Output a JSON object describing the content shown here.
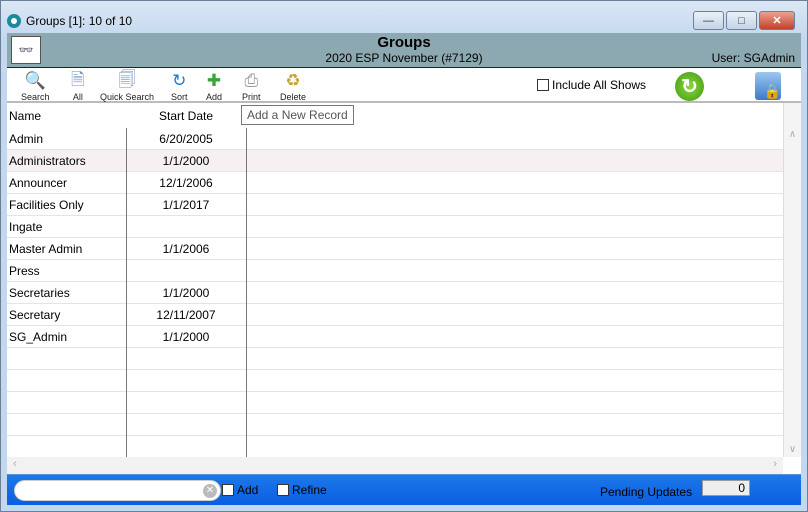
{
  "window": {
    "title": "Groups [1]: 10 of 10"
  },
  "header": {
    "title": "Groups",
    "subtitle": "2020 ESP November (#7129)",
    "user": "User: SGAdmin"
  },
  "toolbar": {
    "search": "Search",
    "all": "All",
    "quick_search": "Quick Search",
    "sort": "Sort",
    "add": "Add",
    "print": "Print",
    "delete": "Delete",
    "include_all_shows": "Include All Shows"
  },
  "tooltip": "Add a New Record",
  "grid": {
    "columns": [
      "Name",
      "Start Date"
    ],
    "rows": [
      [
        "Admin",
        "6/20/2005"
      ],
      [
        "Administrators",
        "1/1/2000"
      ],
      [
        "Announcer",
        "12/1/2006"
      ],
      [
        "Facilities Only",
        "1/1/2017"
      ],
      [
        "Ingate",
        ""
      ],
      [
        "Master Admin",
        "1/1/2006"
      ],
      [
        "Press",
        ""
      ],
      [
        "Secretaries",
        "1/1/2000"
      ],
      [
        "Secretary",
        "12/11/2007"
      ],
      [
        "SG_Admin",
        "1/1/2000"
      ]
    ]
  },
  "bottom": {
    "search_value": "",
    "add_label": "Add",
    "refine_label": "Refine",
    "pending_label": "Pending Updates",
    "pending_value": "0"
  }
}
